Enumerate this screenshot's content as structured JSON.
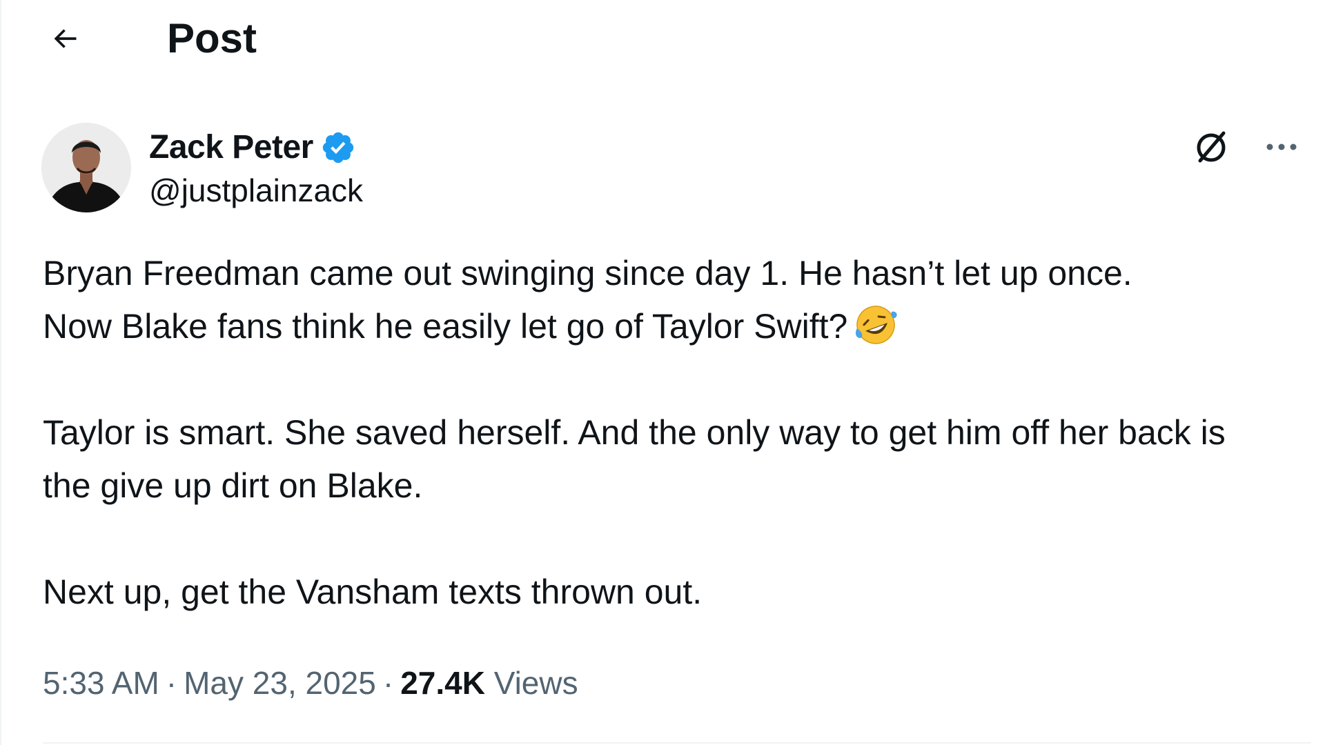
{
  "header": {
    "back_icon": "arrow-left-icon",
    "title": "Post"
  },
  "author": {
    "display_name": "Zack Peter",
    "handle": "@justplainzack",
    "verified": true,
    "verified_color": "#1d9bf0"
  },
  "actions": {
    "grok_icon": "grok-icon",
    "more_icon": "more-horizontal-icon"
  },
  "tweet": {
    "paragraph_1_line_1": "Bryan Freedman came out swinging since day 1. He hasn’t let up once.",
    "paragraph_1_line_2": "Now Blake fans think he easily let go of Taylor Swift?",
    "emoji": "🤣",
    "paragraph_2": "Taylor is smart. She saved herself. And the only way to get him off her back is the give up dirt on Blake.",
    "paragraph_3": "Next up, get the Vansham texts thrown out."
  },
  "meta": {
    "time": "5:33 AM",
    "separator": "·",
    "date": "May 23, 2025",
    "views_count": "27.4K",
    "views_label": "Views"
  },
  "colors": {
    "text_primary": "#0f1419",
    "text_secondary": "#536471",
    "divider": "#eff3f4"
  }
}
